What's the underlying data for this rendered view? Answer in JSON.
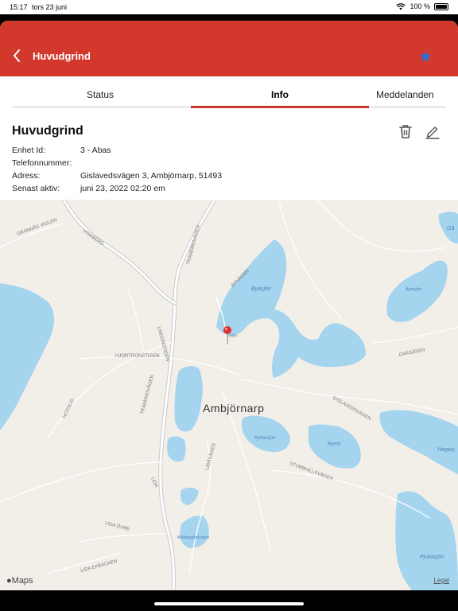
{
  "status_bar": {
    "time": "15:17",
    "date": "tors 23 juni",
    "battery": "100 %"
  },
  "header": {
    "title": "Huvudgrind"
  },
  "tabs": [
    {
      "label": "Status",
      "active": false
    },
    {
      "label": "Info",
      "active": true
    },
    {
      "label": "Meddelanden",
      "active": false
    }
  ],
  "device": {
    "title": "Huvudgrind",
    "fields": [
      {
        "label": "Enhet Id:",
        "value": "3 - Abas"
      },
      {
        "label": "Telefonnummer:",
        "value": ""
      },
      {
        "label": "Adress:",
        "value": "Gislavedsvägen 3, Ambjörnarp, 51493"
      },
      {
        "label": "Senast aktiv:",
        "value": "juni 23, 2022 02:20 em"
      }
    ]
  },
  "map": {
    "town_label": "Ambjörnarp",
    "lakes": [
      "Byasjön",
      "Agnsjön",
      "Kyrkesjön",
      "Ryen",
      "Hagasj",
      "Mellangårdssjön",
      "Pjukasjön",
      "Gå"
    ],
    "roads": [
      "GRÄNNÅS VIOLEN",
      "VISEBERG",
      "TRANEMOVÄGEN",
      "BYVÄGEN",
      "LINDONSTIGEN",
      "HJORTRONSTIGEN",
      "HOSSLID",
      "TRANEMOVÄGEN",
      "GRÄSÅSEN",
      "GISLAVEDSVÄGEN",
      "LIDÅVÄGEN",
      "STUBBHILLSVÄGEN",
      "LIDA",
      "LIDA ÖVRE",
      "LIDA EKBACKEN"
    ],
    "brand": "Maps",
    "legal": "Legal"
  },
  "colors": {
    "accent": "#d3382c",
    "star": "#2f6fd8",
    "water": "#a5d4ef"
  },
  "icons": {
    "back": "chevron-left-icon",
    "favorite": "star-icon",
    "delete": "trash-icon",
    "edit": "pencil-icon",
    "pin": "map-pin-icon"
  }
}
